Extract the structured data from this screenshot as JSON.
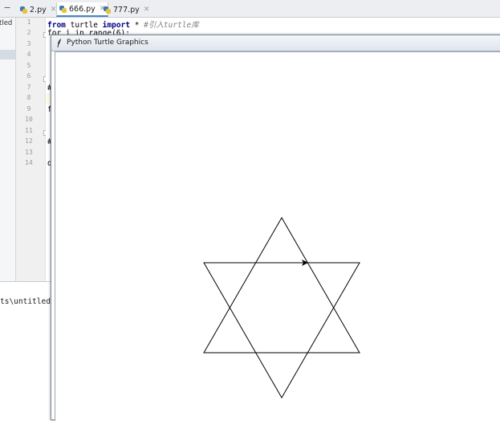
{
  "ide": {
    "tabs": [
      {
        "label": "2.py",
        "active": false
      },
      {
        "label": "666.py",
        "active": true
      },
      {
        "label": "777.py",
        "active": false
      }
    ],
    "project_label": "tled",
    "line_numbers": [
      "1",
      "2",
      "3",
      "4",
      "5",
      "6",
      "7",
      "8",
      "9",
      "10",
      "11",
      "12",
      "13",
      "14"
    ],
    "code": {
      "line1_kw1": "from",
      "line1_mod": " turtle ",
      "line1_kw2": "import",
      "line1_star": " * ",
      "line1_comment": "#引入turtle库",
      "line2_text": "for i in range(6):",
      "line7_text": "#",
      "line9_text": "f",
      "line12_text": "#",
      "line14_text": "d"
    },
    "console_path": "ts\\untitled\\v"
  },
  "turtle_window": {
    "title": "Python Turtle Graphics",
    "figure": {
      "shape": "hexagram",
      "stroke_color": "#000000",
      "background": "#ffffff"
    }
  },
  "colors": {
    "tab_active_underline": "#4a86c8",
    "keyword": "#000080",
    "comment": "#808080"
  }
}
